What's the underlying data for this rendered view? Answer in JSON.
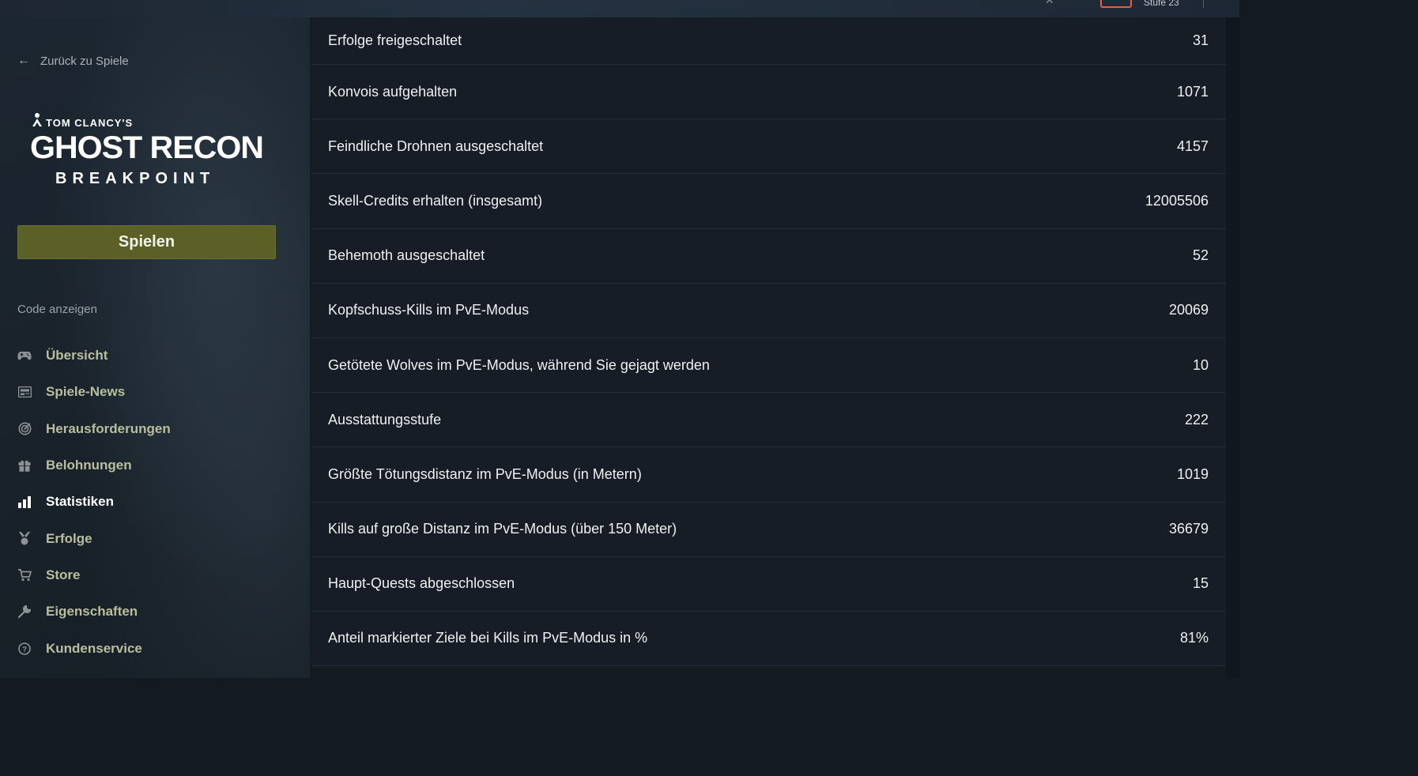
{
  "topbar": {
    "level_text": "Stufe 23"
  },
  "sidebar": {
    "back_label": "Zurück zu Spiele",
    "logo": {
      "line1": "TOM CLANCY'S",
      "line2": "GHOST RECON",
      "line3": "BREAKPOINT"
    },
    "play_label": "Spielen",
    "code_label": "Code anzeigen",
    "nav": [
      {
        "label": "Übersicht",
        "icon": "gamepad-icon",
        "active": false
      },
      {
        "label": "Spiele-News",
        "icon": "news-icon",
        "active": false
      },
      {
        "label": "Herausforderungen",
        "icon": "target-icon",
        "active": false
      },
      {
        "label": "Belohnungen",
        "icon": "gift-icon",
        "active": false
      },
      {
        "label": "Statistiken",
        "icon": "bar-chart-icon",
        "active": true
      },
      {
        "label": "Erfolge",
        "icon": "medal-icon",
        "active": false
      },
      {
        "label": "Store",
        "icon": "cart-icon",
        "active": false
      },
      {
        "label": "Eigenschaften",
        "icon": "wrench-icon",
        "active": false
      },
      {
        "label": "Kundenservice",
        "icon": "help-icon",
        "active": false
      }
    ]
  },
  "stats": [
    {
      "label": "Erfolge freigeschaltet",
      "value": "31"
    },
    {
      "label": "Konvois aufgehalten",
      "value": "1071"
    },
    {
      "label": "Feindliche Drohnen ausgeschaltet",
      "value": "4157"
    },
    {
      "label": "Skell-Credits erhalten (insgesamt)",
      "value": "12005506"
    },
    {
      "label": "Behemoth ausgeschaltet",
      "value": "52"
    },
    {
      "label": "Kopfschuss-Kills im PvE-Modus",
      "value": "20069"
    },
    {
      "label": "Getötete Wolves im PvE-Modus, während Sie gejagt werden",
      "value": "10"
    },
    {
      "label": "Ausstattungsstufe",
      "value": "222"
    },
    {
      "label": "Größte Tötungsdistanz im PvE-Modus (in Metern)",
      "value": "1019"
    },
    {
      "label": "Kills auf große Distanz im PvE-Modus (über 150 Meter)",
      "value": "36679"
    },
    {
      "label": "Haupt-Quests abgeschlossen",
      "value": "15"
    },
    {
      "label": "Anteil markierter Ziele bei Kills im PvE-Modus in %",
      "value": "81%"
    }
  ],
  "colors": {
    "play_button": "#5b6126",
    "level_border": "#e0613f",
    "background": "#131a22"
  }
}
